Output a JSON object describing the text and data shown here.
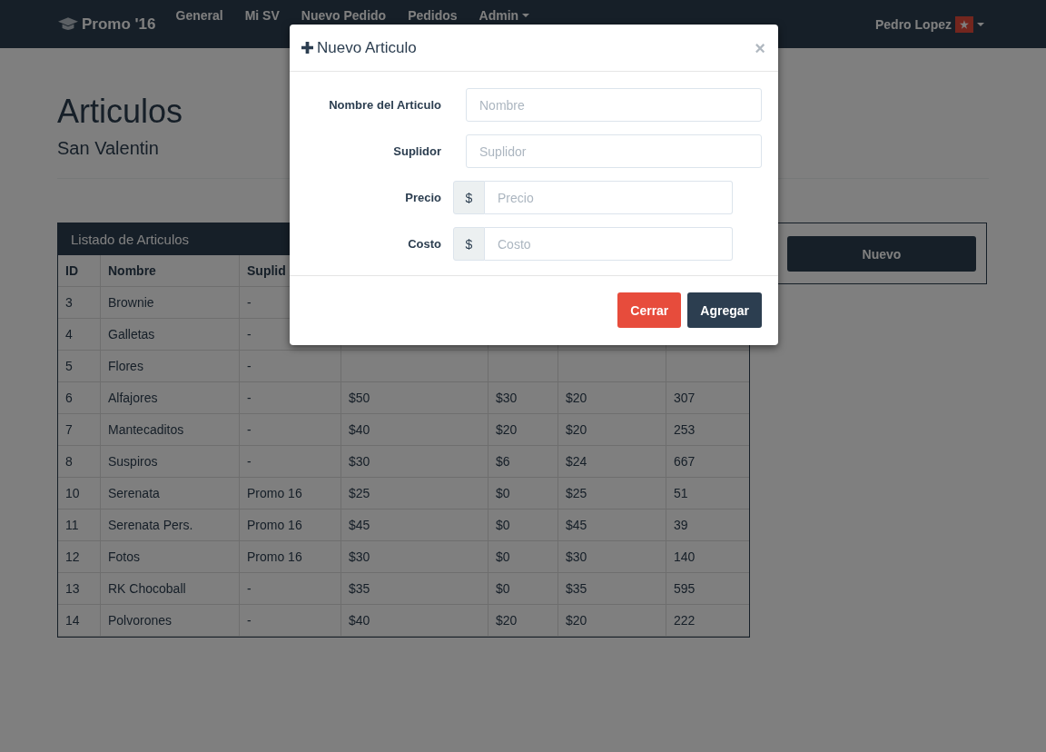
{
  "navbar": {
    "brand": "Promo '16",
    "items": [
      {
        "label": "General",
        "dropdown": false
      },
      {
        "label": "Mi SV",
        "dropdown": false
      },
      {
        "label": "Nuevo Pedido",
        "dropdown": false
      },
      {
        "label": "Pedidos",
        "dropdown": false
      },
      {
        "label": "Admin",
        "dropdown": true
      }
    ],
    "user": {
      "name": "Pedro Lopez",
      "badge": "★"
    }
  },
  "header": {
    "title": "Articulos",
    "subtitle": "San Valentin"
  },
  "panel": {
    "title": "Listado de Articulos",
    "columns": [
      "ID",
      "Nombre",
      "Suplid"
    ],
    "rows": [
      [
        "3",
        "Brownie",
        "-"
      ],
      [
        "4",
        "Galletas",
        "-"
      ],
      [
        "5",
        "Flores",
        "-"
      ],
      [
        "6",
        "Alfajores",
        "-",
        "$50",
        "$30",
        "$20",
        "307"
      ],
      [
        "7",
        "Mantecaditos",
        "-",
        "$40",
        "$20",
        "$20",
        "253"
      ],
      [
        "8",
        "Suspiros",
        "-",
        "$30",
        "$6",
        "$24",
        "667"
      ],
      [
        "10",
        "Serenata",
        "Promo 16",
        "$25",
        "$0",
        "$25",
        "51"
      ],
      [
        "11",
        "Serenata Pers.",
        "Promo 16",
        "$45",
        "$0",
        "$45",
        "39"
      ],
      [
        "12",
        "Fotos",
        "Promo 16",
        "$30",
        "$0",
        "$30",
        "140"
      ],
      [
        "13",
        "RK Chocoball",
        "-",
        "$35",
        "$0",
        "$35",
        "595"
      ],
      [
        "14",
        "Polvorones",
        "-",
        "$40",
        "$20",
        "$20",
        "222"
      ]
    ]
  },
  "side_button": "Nuevo",
  "modal": {
    "title": "Nuevo Articulo",
    "close": "×",
    "fields": [
      {
        "kind": "text",
        "label": "Nombre del Articulo",
        "placeholder": "Nombre"
      },
      {
        "kind": "text",
        "label": "Suplidor",
        "placeholder": "Suplidor"
      },
      {
        "kind": "currency",
        "label": "Precio",
        "addon": "$",
        "placeholder": "Precio"
      },
      {
        "kind": "currency",
        "label": "Costo",
        "addon": "$",
        "placeholder": "Costo"
      }
    ],
    "buttons": [
      {
        "kind": "danger",
        "label": "Cerrar"
      },
      {
        "kind": "primary",
        "label": "Agregar"
      }
    ]
  }
}
